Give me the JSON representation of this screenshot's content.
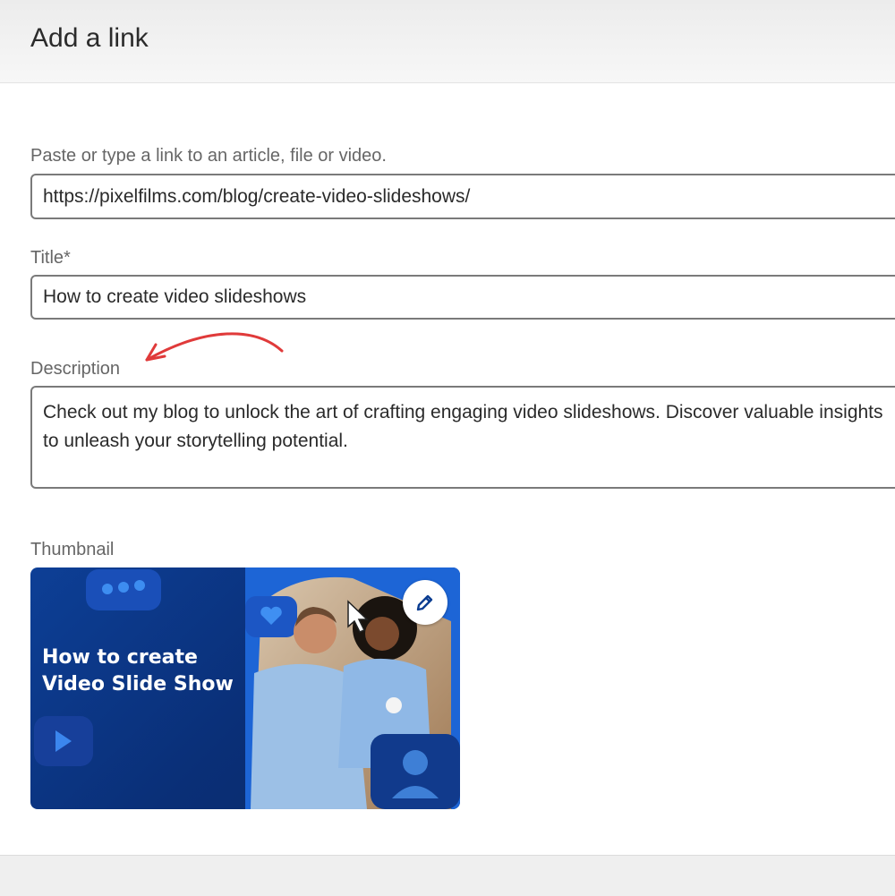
{
  "dialog": {
    "title": "Add a link"
  },
  "link_field": {
    "label": "Paste or type a link to an article, file or video.",
    "value": "https://pixelfilms.com/blog/create-video-slideshows/"
  },
  "title_field": {
    "label": "Title*",
    "value": "How to create video slideshows"
  },
  "description_field": {
    "label": "Description",
    "line1": "Check out my blog to unlock the art of crafting engaging video slideshows. Discover valuable insights",
    "line2": "to unleash your storytelling potential."
  },
  "thumbnail": {
    "label": "Thumbnail",
    "line1": "How to create",
    "line2": "Video Slide Show",
    "edit_icon": "pencil-icon"
  },
  "colors": {
    "annotation_arrow": "#e03a3a",
    "thumb_blue": "#0d3f96",
    "thumb_accent": "#1e6fd9"
  }
}
